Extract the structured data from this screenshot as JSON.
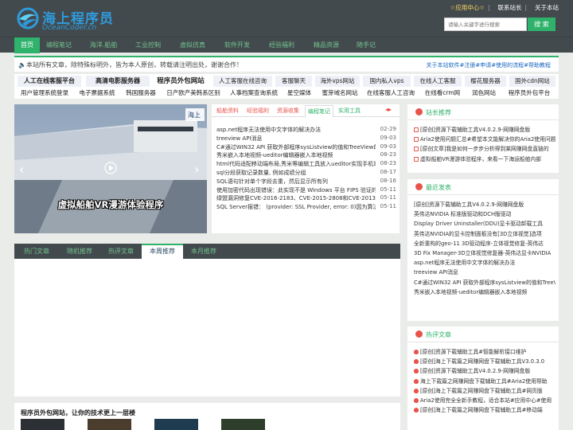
{
  "header": {
    "logo_cn": "海上程序员",
    "logo_en": "OceanCoder.cn",
    "toplinks": [
      "☆应用中心☆",
      "联系站长",
      "关于本站"
    ],
    "search_placeholder": "请输入关键字进行搜索",
    "search_button": "搜 索"
  },
  "nav": [
    "首页",
    "编程笔记",
    "海洋.船舶",
    "工业控制",
    "虚拟仿真",
    "软件开发",
    "经验福利",
    "精品资源",
    "随手记"
  ],
  "notice": {
    "left": "本站所有文章，除特殊标明外，皆为本人原创，转载请注明出处，谢谢合作！",
    "right": "关于本站软件#注册#申请#使用的流程#帮助教程"
  },
  "links": {
    "row1": [
      "人工在线客服平台",
      "高清电影服务器",
      "程序员外包网站",
      "人工客服在线咨询",
      "客服聊天",
      "海外vps网站",
      "国内私人vps",
      "在线人工客服",
      "樱花服务器",
      "国外cdn网站"
    ],
    "row2": [
      "用户管理系统登录",
      "电子票据系统",
      "韩国服务器",
      "日产欧产美韩系区别",
      "人事档案查询系统",
      "星空媒体",
      "蜜芽域名网站",
      "在线客服人工咨询",
      "在线看crm网",
      "润色网站",
      "程序员外包平台"
    ]
  },
  "slider": {
    "caption": "虚拟船舶VR漫游体验程序"
  },
  "news": {
    "tabs": [
      "船舶资料",
      "经验福利",
      "资源收集",
      "编程笔记",
      "实用工具"
    ],
    "active_tab": 3,
    "items": [
      {
        "title": "asp.net程序无法使用中文字体的解决办法",
        "date": "02-29"
      },
      {
        "title": "treeview API消息",
        "date": "09-03"
      },
      {
        "title": "C#通过WIN32 API 获取外部程序sysListview的值和TreeView的值",
        "date": "09-03"
      },
      {
        "title": "秀米嵌入本地视频-ueditor编辑器嵌入本地视频",
        "date": "08-23"
      },
      {
        "title": "html代码适配移动端布局,秀米等编辑工具放入ueditor实现手机端效果",
        "date": "08-23"
      },
      {
        "title": "sql分段获取记录数量, 例如成绩分组",
        "date": "08-17"
      },
      {
        "title": "SQL语句针对单个字段去重，然后显示所有列",
        "date": "08-16"
      },
      {
        "title": "使用加密代码出现错误：此实现不是 Windows 平台 FIPS 验证的加密算法的一部分",
        "date": "05-11"
      },
      {
        "title": "绿盟漏洞修复CVE-2016-2183、CVE-2015-2808和CVE-2013-2566",
        "date": "05-11"
      },
      {
        "title": "SQL Server报错： (provider: SSL Provider, error: 0)因为算法不同",
        "date": "05-11"
      }
    ]
  },
  "tabs": [
    "热门文章",
    "随机推荐",
    "热评文章",
    "本周推荐",
    "本月推荐"
  ],
  "active_tab": 3,
  "bottom": {
    "title": "程序员外包网站，让你的技术更上一层楼"
  },
  "sidebar": {
    "recommend": {
      "title": "站长推荐",
      "items": [
        "[原创]资源下载辅助工具V4.0.2.9-网赚网盘版",
        "Aria2使用问题汇总#希望本文能解决你的Aria2使用问题",
        "[原创文章]我是如何一步步分析得到某网赚网盘直链的",
        "虚拟船舶VR漫游体验程序，来看一下海运船舶内部"
      ]
    },
    "latest": {
      "title": "最近发表",
      "items": [
        "[原创]资源下载辅助工具V4.0.2.9-网赚网盘版",
        "英伟达NVIDIA 标准版驱动和DCH版驱动",
        "Display Driver Uninstaller(DDU)显卡驱动卸载工具",
        "英伟达NVIDIA的显卡控制面板没有[3D立体视觉]选项",
        "全新重构的geo-11 3D驱动程序-立体视觉修复-英伟达",
        "3D Fix Manager-3D立体视觉修复器-英伟达显卡NVIDIA",
        "asp.net程序无法使用中文字体的解决办法",
        "treeview API消息",
        "C#通过WIN32 API 获取外部程序sysListview的值和TreeView",
        "秀米嵌入本地视频-ueditor编辑器嵌入本地视频"
      ]
    },
    "hot": {
      "title": "热评文章",
      "items": [
        "[原创]资源下载辅助工具#智能解析接口维护",
        "[原创]海上下载篇之网赚网盘下载辅助工具V3.0.3.0",
        "[原创]资源下载辅助工具V4.0.2.9-网赚网盘版",
        "海上下载篇之网赚网盘下载辅助工具#Aria2使用帮助",
        "[原创]海上下载篇之网赚网盘下载辅助工具#网页版",
        "Aria2使用完全全新手教程，适合本站#应用中心#使用",
        "[原创]海上下载篇之网赚网盘下载辅助工具#移动端"
      ]
    }
  }
}
